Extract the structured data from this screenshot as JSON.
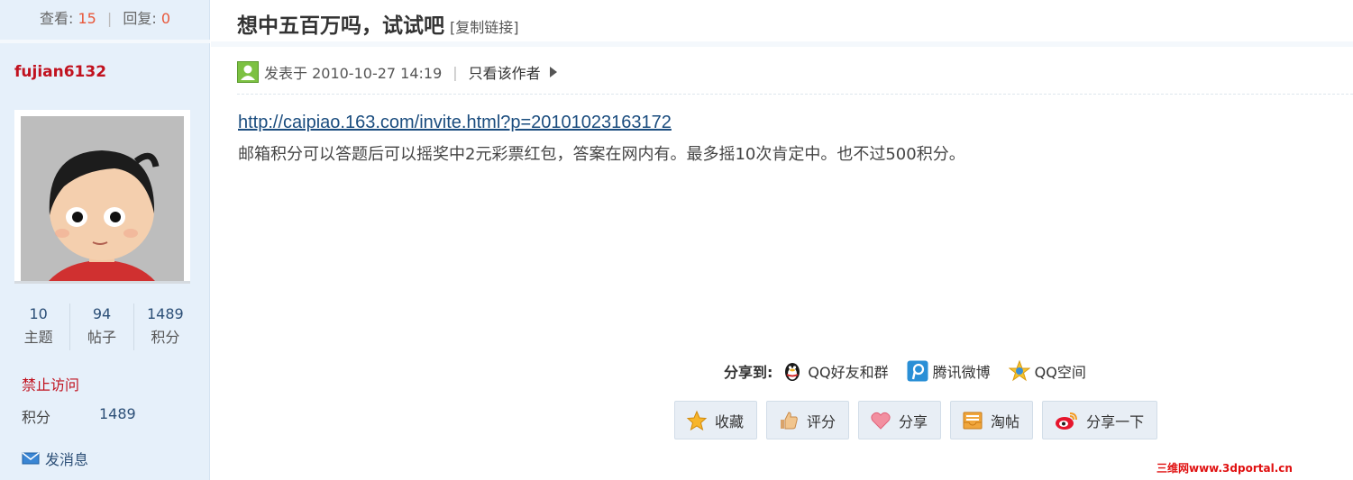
{
  "stats": {
    "views_label": "查看:",
    "views": "15",
    "separator": "|",
    "replies_label": "回复:",
    "replies": "0"
  },
  "author": {
    "username": "fujian6132",
    "counts": [
      {
        "value": "10",
        "label": "主题"
      },
      {
        "value": "94",
        "label": "帖子"
      },
      {
        "value": "1489",
        "label": "积分"
      }
    ],
    "status": "禁止访问",
    "credit_label": "积分",
    "credit_value": "1489",
    "message_label": "发消息"
  },
  "thread": {
    "title": "想中五百万吗，试试吧",
    "copy_link": "[复制链接]"
  },
  "post": {
    "posted_at": "发表于 2010-10-27 14:19",
    "separator": "|",
    "only_author": "只看该作者",
    "link": "http://caipiao.163.com/invite.html?p=20101023163172",
    "text": "邮箱积分可以答题后可以摇奖中2元彩票红包，答案在网内有。最多摇10次肯定中。也不过500积分。"
  },
  "share": {
    "label": "分享到:",
    "targets": [
      "QQ好友和群",
      "腾讯微博",
      "QQ空间"
    ]
  },
  "actions": [
    "收藏",
    "评分",
    "分享",
    "淘帖",
    "分享一下"
  ],
  "watermark": "三维网www.3dportal.cn",
  "colors": {
    "sidebar_bg": "#e6f0fa",
    "username": "#c1121f",
    "link": "#1a4c7e",
    "accent_num": "#e8573a"
  }
}
